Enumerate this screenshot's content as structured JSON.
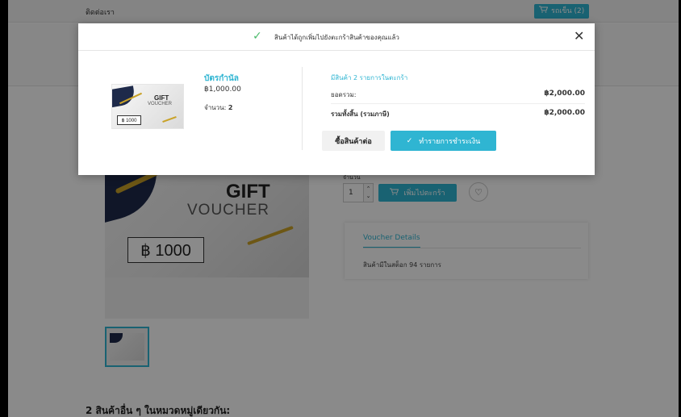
{
  "topbar": {
    "contact_label": "ติดต่อเรา",
    "cart_label": "รถเข็น (2)",
    "cart_icon": "cart-icon"
  },
  "product_page": {
    "gift_word": "GIFT",
    "voucher_word": "VOUCHER",
    "amount": "฿ 1000",
    "quantity_label": "จำนวน",
    "quantity_value": "1",
    "add_to_cart_label": "เพิ่มไปตะกร้า",
    "wishlist_icon": "heart-icon",
    "tab_label": "Voucher Details",
    "stock_text": "สินค้ามีในสต็อก 94 รายการ",
    "related_heading": "2 สินค้าอื่น ๆ ในหมวดหมู่เดียวกัน:"
  },
  "modal": {
    "title": "สินค้าได้ถูกเพิ่มไปยังตะกร้าสินค้าของคุณแล้ว",
    "check_icon": "check-icon",
    "close_icon": "close-icon",
    "close_glyph": "✕",
    "product": {
      "name": "บัตรกำนัล",
      "price": "฿1,000.00",
      "quantity_label": "จำนวน:",
      "quantity_value": "2",
      "thumb_gift": "GIFT",
      "thumb_voucher": "VOUCHER",
      "thumb_amount": "฿ 1000"
    },
    "cart": {
      "count_text": "มีสินค้า 2 รายการในตะกร้า",
      "subtotal_label": "ยอดรวม:",
      "subtotal_value": "฿2,000.00",
      "total_label": "รวมทั้งสิ้น (รวมภาษี)",
      "total_value": "฿2,000.00"
    },
    "continue_label": "ซื้อสินค้าต่อ",
    "checkout_label": "ทำรายการชำระเงิน"
  },
  "colors": {
    "accent": "#2fb5d2",
    "success": "#4cbb6c",
    "overlay": "rgba(0,0,0,0.46)"
  }
}
